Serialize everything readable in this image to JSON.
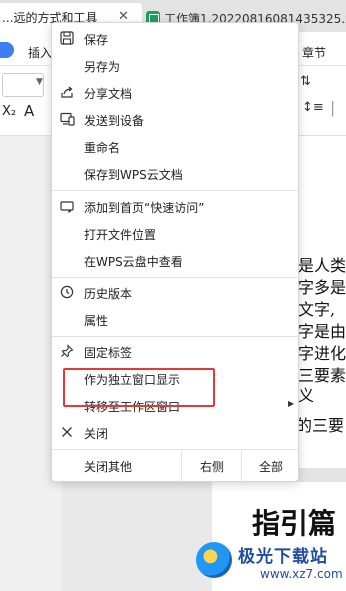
{
  "tabs": {
    "active_title": "...远的方式和工具",
    "active_close": "✕",
    "second_title": "工作簿1.20220816081435325.xl"
  },
  "ribbon": {
    "insert_label": "插入",
    "chapter_label": "章节"
  },
  "document": {
    "lines": [
      "是人类",
      "字多是",
      "文字,",
      "字是由",
      "字进化",
      "三要素",
      "义",
      "的三要"
    ],
    "heading": "指引篇"
  },
  "menu": {
    "items": [
      {
        "icon": "save-icon",
        "label": "保存"
      },
      {
        "icon": "",
        "label": "另存为"
      },
      {
        "icon": "share-icon",
        "label": "分享文档"
      },
      {
        "icon": "device-icon",
        "label": "发送到设备"
      },
      {
        "icon": "",
        "label": "重命名"
      },
      {
        "icon": "",
        "label": "保存到WPS云文档"
      },
      {
        "icon": "pin-home-icon",
        "label": "添加到首页“快速访问”"
      },
      {
        "icon": "",
        "label": "打开文件位置"
      },
      {
        "icon": "",
        "label": "在WPS云盘中查看"
      },
      {
        "icon": "history-icon",
        "label": "历史版本"
      },
      {
        "icon": "",
        "label": "属性"
      },
      {
        "icon": "pin-icon",
        "label": "固定标签"
      },
      {
        "icon": "",
        "label": "作为独立窗口显示"
      },
      {
        "icon": "",
        "label": "转移至工作区窗口",
        "submenu": true
      },
      {
        "icon": "close-icon",
        "label": "关闭"
      }
    ],
    "bottom": {
      "close_others": "关闭其他",
      "right": "右侧",
      "all": "全部"
    }
  },
  "watermark": {
    "title": "极光下载站",
    "url": "www.xz7.com"
  },
  "colors": {
    "highlight": "#e53935",
    "accent": "#3b7ff0"
  }
}
